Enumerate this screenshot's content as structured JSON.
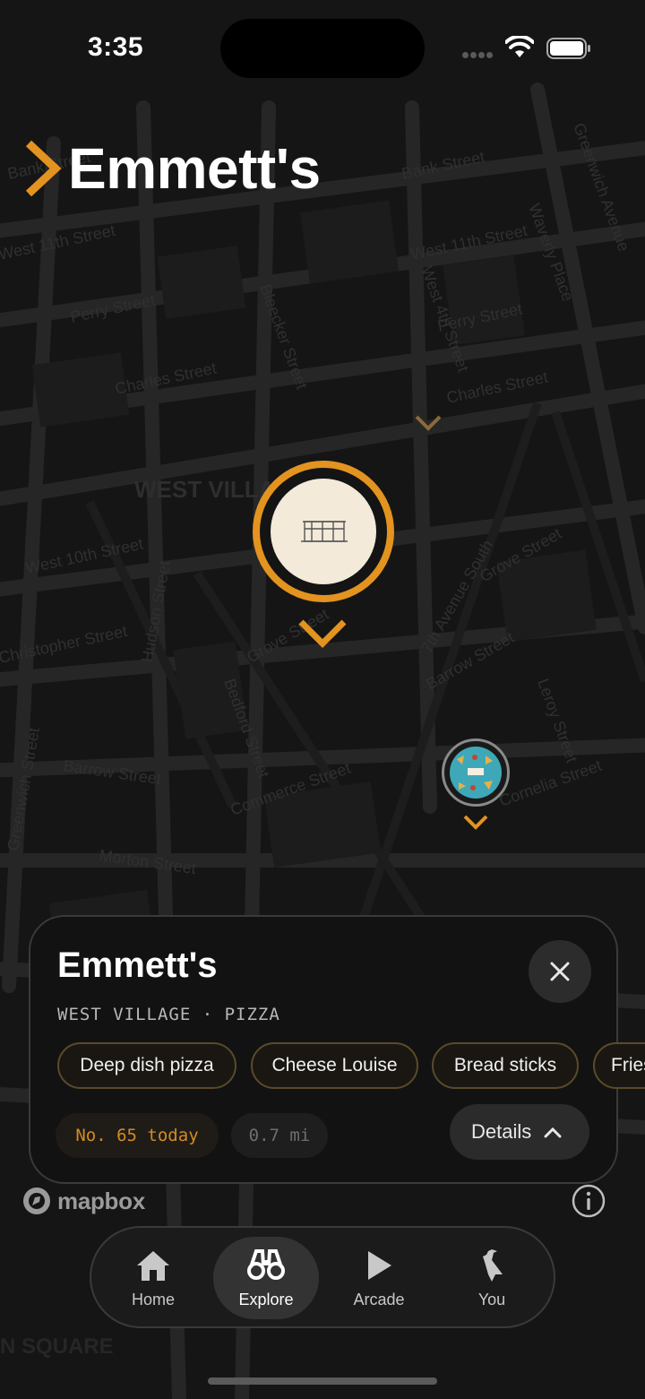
{
  "status_bar": {
    "time": "3:35"
  },
  "header": {
    "title": "Emmett's"
  },
  "map": {
    "street_labels": [
      "Bank Street",
      "Bank Street",
      "West 11th Street",
      "West 11th Street",
      "Perry Street",
      "Perry Street",
      "Charles Street",
      "Charles Street",
      "West 4th Street",
      "Bleecker Street",
      "Greenwich Avenue",
      "Waverly Place",
      "West 10th Street",
      "Christopher Street",
      "Hudson Street",
      "Grove Street",
      "Grove Street",
      "7th Avenue South",
      "Bedford Street",
      "Barrow Street",
      "Barrow Street",
      "Commerce Street",
      "Morton Street",
      "Cornelia Street",
      "Greenwich Street",
      "Leroy Street"
    ],
    "area_label": "WEST VILLAGE",
    "bottom_label": "N SQUARE"
  },
  "card": {
    "title": "Emmett's",
    "subtitle": "WEST VILLAGE · PIZZA",
    "chips": [
      "Deep dish pizza",
      "Cheese Louise",
      "Bread sticks",
      "Fries"
    ],
    "rank": "No. 65 today",
    "distance": "0.7 mi",
    "details_label": "Details"
  },
  "attribution": {
    "mapbox": "mapbox"
  },
  "tabbar": {
    "items": [
      {
        "label": "Home",
        "icon": "house-icon",
        "active": false
      },
      {
        "label": "Explore",
        "icon": "binoculars-icon",
        "active": true
      },
      {
        "label": "Arcade",
        "icon": "play-icon",
        "active": false
      },
      {
        "label": "You",
        "icon": "bird-icon",
        "active": false
      }
    ]
  },
  "colors": {
    "accent": "#e39320",
    "background": "#141414",
    "card": "#121212"
  }
}
